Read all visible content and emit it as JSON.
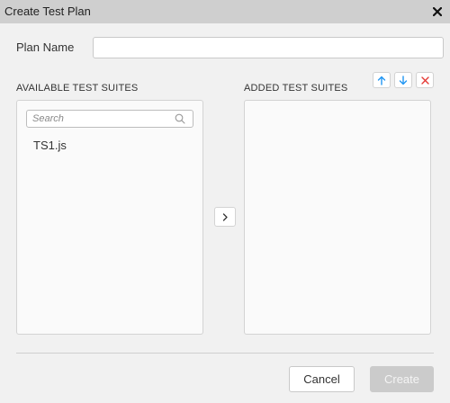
{
  "dialog": {
    "title": "Create Test Plan"
  },
  "form": {
    "plan_name_label": "Plan Name",
    "plan_name_value": "",
    "plan_name_placeholder": ""
  },
  "available": {
    "label": "AVAILABLE TEST SUITES",
    "search_placeholder": "Search",
    "items": [
      "TS1.js"
    ]
  },
  "added": {
    "label": "ADDED TEST SUITES",
    "items": []
  },
  "toolbar": {
    "icons": [
      "arrow-up-icon",
      "arrow-down-icon",
      "remove-icon"
    ],
    "up_color": "#2196f3",
    "down_color": "#2196f3",
    "remove_color": "#e53935"
  },
  "footer": {
    "cancel_label": "Cancel",
    "create_label": "Create"
  }
}
